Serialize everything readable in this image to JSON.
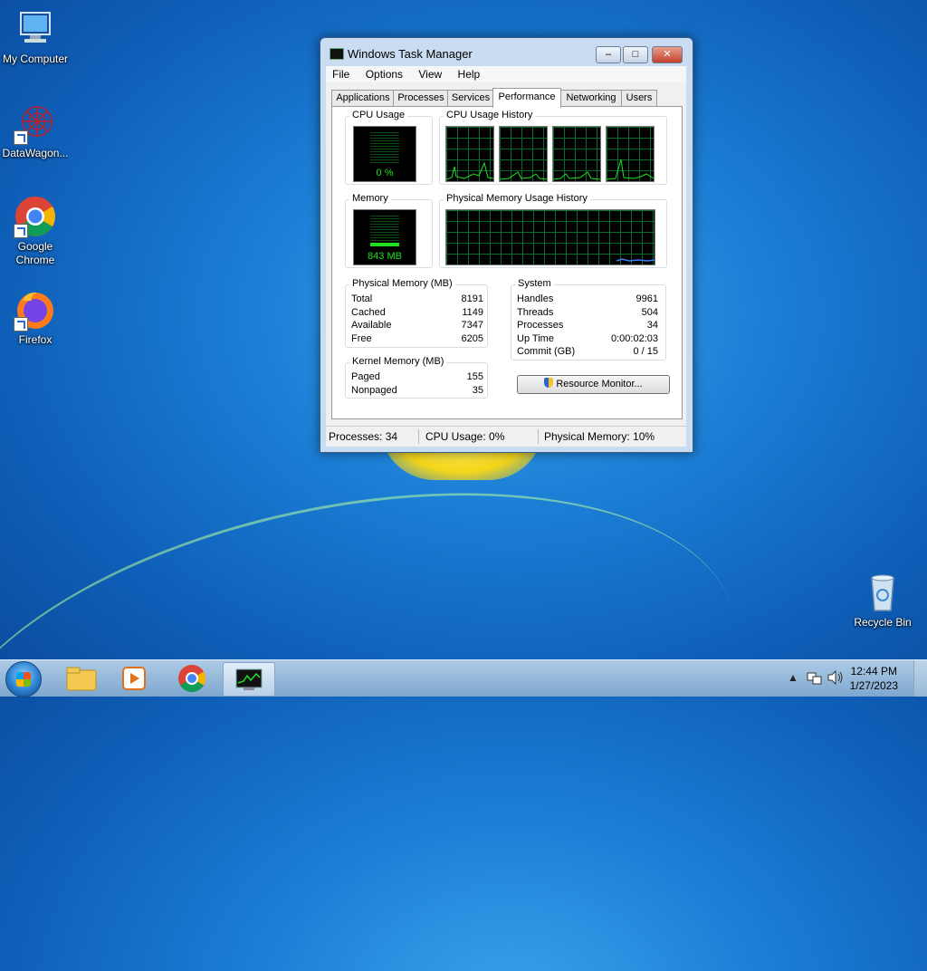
{
  "desktop": {
    "icons": [
      {
        "label": "My Computer"
      },
      {
        "label": "DataWagon..."
      },
      {
        "label": "Google Chrome"
      },
      {
        "label": "Firefox"
      },
      {
        "label": "Recycle Bin"
      }
    ]
  },
  "window": {
    "title": "Windows Task Manager",
    "minimize": "–",
    "maximize": "□",
    "close": "✕",
    "menu": [
      "File",
      "Options",
      "View",
      "Help"
    ],
    "tabs": [
      "Applications",
      "Processes",
      "Services",
      "Performance",
      "Networking",
      "Users"
    ],
    "active_tab": "Performance"
  },
  "performance": {
    "cpu_usage_label": "CPU Usage",
    "cpu_usage_value": "0 %",
    "cpu_history_label": "CPU Usage History",
    "memory_label": "Memory",
    "memory_value": "843 MB",
    "memory_history_label": "Physical Memory Usage History",
    "physical_memory": {
      "title": "Physical Memory (MB)",
      "rows": [
        {
          "label": "Total",
          "value": "8191"
        },
        {
          "label": "Cached",
          "value": "1149"
        },
        {
          "label": "Available",
          "value": "7347"
        },
        {
          "label": "Free",
          "value": "6205"
        }
      ]
    },
    "kernel_memory": {
      "title": "Kernel Memory (MB)",
      "rows": [
        {
          "label": "Paged",
          "value": "155"
        },
        {
          "label": "Nonpaged",
          "value": "35"
        }
      ]
    },
    "system": {
      "title": "System",
      "rows": [
        {
          "label": "Handles",
          "value": "9961"
        },
        {
          "label": "Threads",
          "value": "504"
        },
        {
          "label": "Processes",
          "value": "34"
        },
        {
          "label": "Up Time",
          "value": "0:00:02:03"
        },
        {
          "label": "Commit (GB)",
          "value": "0 / 15"
        }
      ]
    },
    "resource_monitor_button": "Resource Monitor..."
  },
  "status": {
    "processes": "Processes: 34",
    "cpu": "CPU Usage: 0%",
    "memory": "Physical Memory: 10%"
  },
  "taskbar": {
    "time": "12:44 PM",
    "date": "1/27/2023",
    "tray_arrow": "▲"
  },
  "colors": {
    "graph_line": "#20e020",
    "memory_line": "#3a7cff",
    "grid": "#0a6b2e"
  }
}
